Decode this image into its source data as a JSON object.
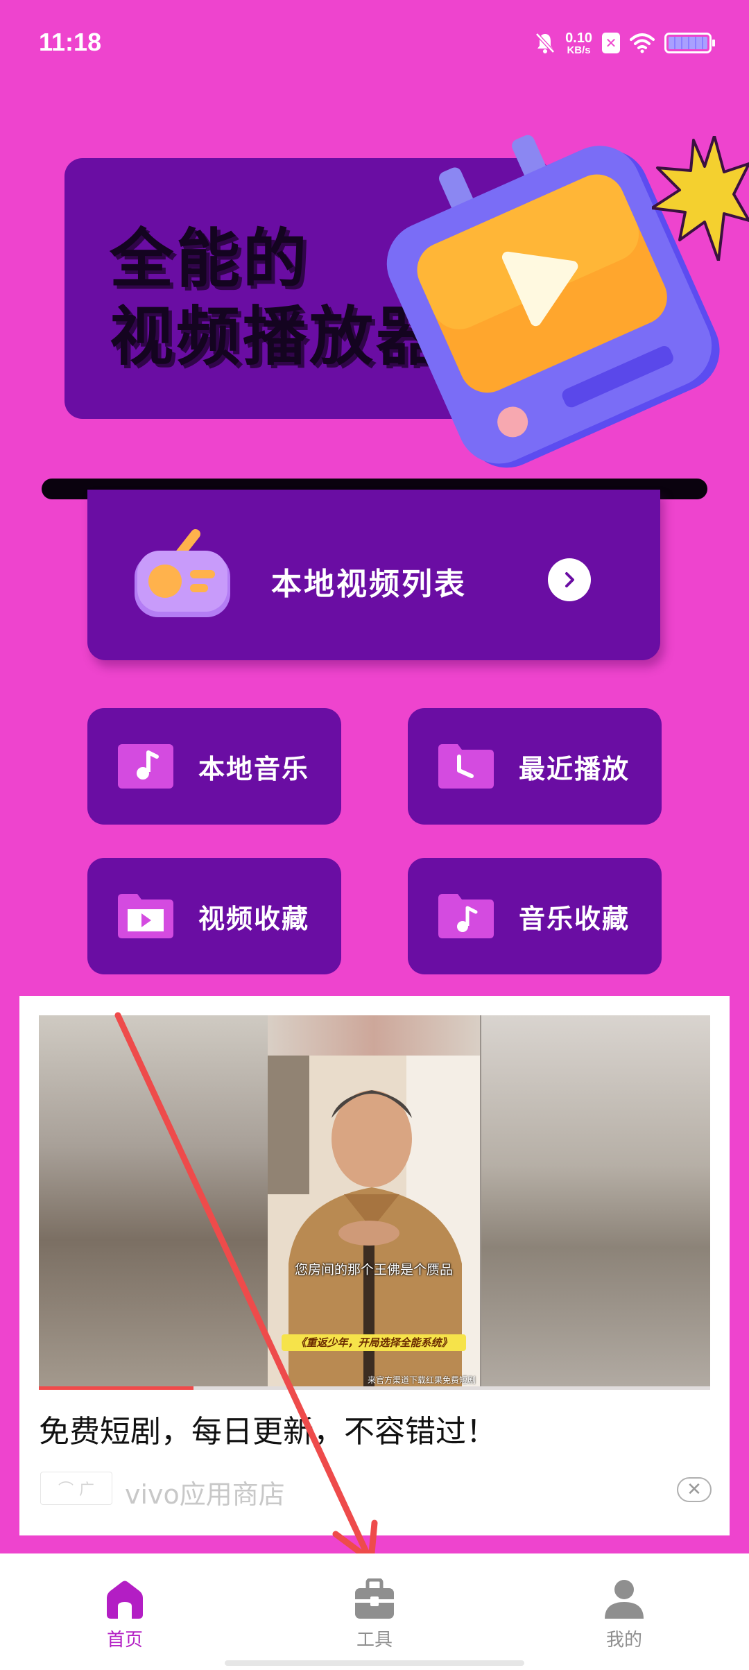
{
  "status_bar": {
    "time": "11:18",
    "net_speed_value": "0.10",
    "net_speed_unit": "KB/s",
    "icons": [
      "bell-muted-icon",
      "sim-off-icon",
      "wifi-icon",
      "battery-icon"
    ]
  },
  "banner": {
    "title_line1": "全能的",
    "title_line2": "视频播放器"
  },
  "local_video_list": {
    "label": "本地视频列表"
  },
  "grid": [
    {
      "label": "本地音乐",
      "icon": "music-note-icon"
    },
    {
      "label": "最近播放",
      "icon": "recent-folder-icon"
    },
    {
      "label": "视频收藏",
      "icon": "video-folder-icon"
    },
    {
      "label": "音乐收藏",
      "icon": "music-folder-icon"
    }
  ],
  "ad": {
    "subtitle": "您房间的那个王佛是个赝品",
    "yellow_banner": "《重返少年，开局选择全能系统》",
    "credit": "来官方渠道下载红果免费短剧",
    "progress": 0.23,
    "headline": "免费短剧，每日更新，不容错过！",
    "badge": "广",
    "source": "vivo应用商店"
  },
  "bottom_nav": {
    "home": "首页",
    "tools": "工具",
    "mine": "我的"
  },
  "colors": {
    "background": "#EE44CE",
    "card": "#6A0DA3",
    "nav_active": "#B31EC4",
    "nav_inactive": "#8F8F8F"
  }
}
